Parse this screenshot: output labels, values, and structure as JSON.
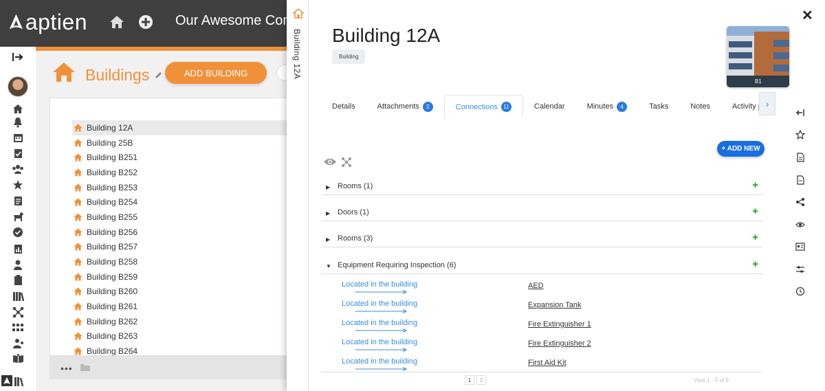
{
  "app": {
    "logo_text": "aptien",
    "company_name": "Our Awesome Company",
    "accent_color": "#f0913a",
    "link_color": "#3a8dde"
  },
  "buildings_page": {
    "title": "Buildings",
    "add_button_label": "ADD BUILDING",
    "tree_items": [
      "Building 12A",
      "Building 25B",
      "Building B251",
      "Building B252",
      "Building B253",
      "Building B254",
      "Building B255",
      "Building B256",
      "Building B257",
      "Building B258",
      "Building B259",
      "Building B260",
      "Building B261",
      "Building B262",
      "Building B263",
      "Building B264"
    ],
    "selected_item": "Building 12A",
    "footer_dots": "•••"
  },
  "detail": {
    "vertical_title": "Building 12A",
    "name": "Building 12A",
    "tag": "Building",
    "photo_label": "B1",
    "tabs": [
      {
        "label": "Details",
        "badge": ""
      },
      {
        "label": "Attachments",
        "badge": "2"
      },
      {
        "label": "Connections",
        "badge": "11"
      },
      {
        "label": "Calendar",
        "badge": ""
      },
      {
        "label": "Minutes",
        "badge": "4"
      },
      {
        "label": "Tasks",
        "badge": ""
      },
      {
        "label": "Notes",
        "badge": ""
      },
      {
        "label": "Activity p",
        "badge": ""
      }
    ],
    "active_tab": "Connections",
    "add_new_label": "+ ADD NEW",
    "groups": [
      {
        "label": "Rooms (1)",
        "expanded": false
      },
      {
        "label": "Doors (1)",
        "expanded": false
      },
      {
        "label": "Rooms (3)",
        "expanded": false
      },
      {
        "label": "Equipment Requiring Inspection (6)",
        "expanded": true
      }
    ],
    "connections": [
      {
        "relation": "Located in the building",
        "target": "AED"
      },
      {
        "relation": "Located in the building",
        "target": "Expansion Tank"
      },
      {
        "relation": "Located in the building",
        "target": "Fire Extinguisher 1"
      },
      {
        "relation": "Located in the building",
        "target": "Fire Extinguisher 2"
      },
      {
        "relation": "Located in the building",
        "target": "First Aid Kit"
      }
    ],
    "pages": [
      "1",
      "2"
    ],
    "view_count": "View 1 - 5 of 6"
  }
}
